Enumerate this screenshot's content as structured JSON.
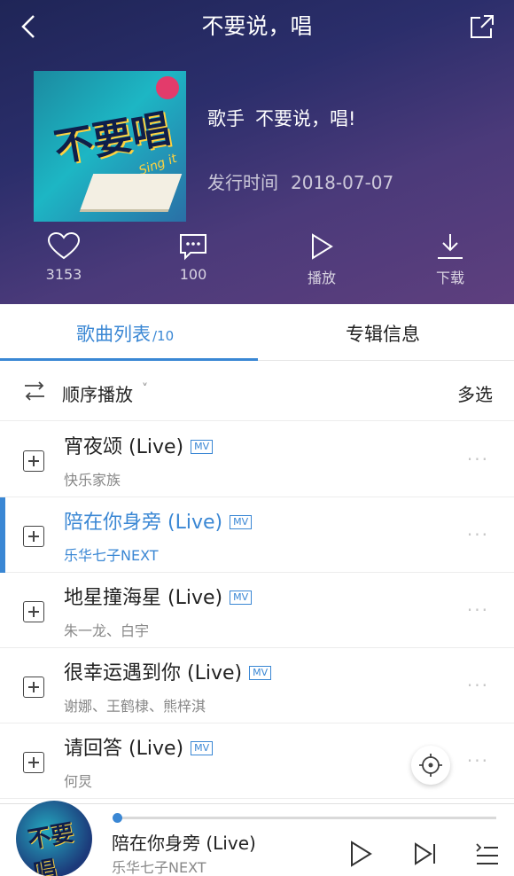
{
  "header": {
    "title": "不要说，唱",
    "singer_label": "歌手",
    "singer": "不要说，唱!",
    "release_label": "发行时间",
    "release_date": "2018-07-07"
  },
  "cover": {
    "logo_text": "不要唱",
    "sub_text": "Sing it"
  },
  "actions": [
    {
      "icon": "heart-icon",
      "label": "3153"
    },
    {
      "icon": "comment-icon",
      "label": "100"
    },
    {
      "icon": "play-icon",
      "label": "播放"
    },
    {
      "icon": "download-icon",
      "label": "下载"
    }
  ],
  "tabs": {
    "songs_label": "歌曲列表",
    "songs_count": "/10",
    "info_label": "专辑信息"
  },
  "sortbar": {
    "order_label": "顺序播放",
    "caret": "˅",
    "multi_select": "多选"
  },
  "songs": [
    {
      "title": "宵夜颂 (Live)",
      "artist": "快乐家族",
      "badge": "MV"
    },
    {
      "title": "陪在你身旁 (Live)",
      "artist": "乐华七子NEXT",
      "badge": "MV"
    },
    {
      "title": "地星撞海星 (Live)",
      "artist": "朱一龙、白宇",
      "badge": "MV"
    },
    {
      "title": "很幸运遇到你 (Live)",
      "artist": "谢娜、王鹤棣、熊梓淇",
      "badge": "MV"
    },
    {
      "title": "请回答 (Live)",
      "artist": "何炅",
      "badge": "MV"
    }
  ],
  "more_glyph": "···",
  "player": {
    "title": "陪在你身旁 (Live)",
    "artist": "乐华七子NEXT",
    "progress": 0.01
  },
  "colors": {
    "accent": "#3a87d4",
    "header_from": "#1f2557",
    "header_to": "#5e3f7e"
  }
}
